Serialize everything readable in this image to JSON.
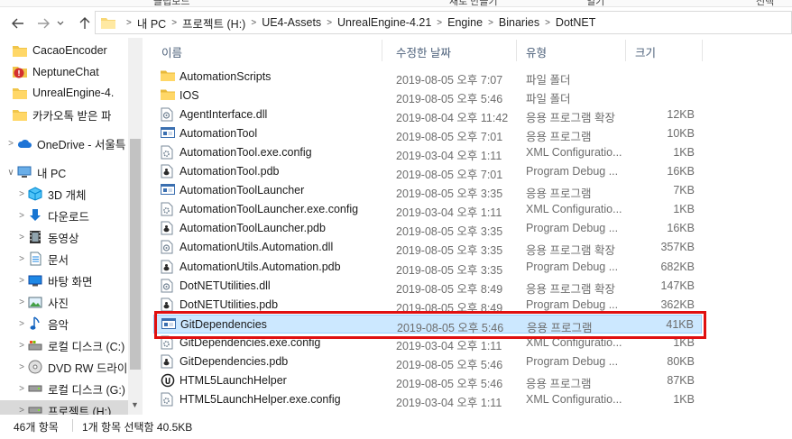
{
  "ribbon": {
    "fragments": [
      "클립보드",
      "새로 만들기",
      "열기",
      "선택"
    ]
  },
  "address_bar": {
    "crumbs": [
      "내 PC",
      "프로젝트 (H:)",
      "UE4-Assets",
      "UnrealEngine-4.21",
      "Engine",
      "Binaries",
      "DotNET"
    ]
  },
  "sidebar": {
    "items": [
      {
        "label": "CacaoEncoder",
        "icon": "folder-icon"
      },
      {
        "label": "NeptuneChat",
        "icon": "folder-error-icon"
      },
      {
        "label": "UnrealEngine-4.",
        "icon": "folder-icon"
      },
      {
        "label": "카카오톡 받은 파",
        "icon": "folder-icon"
      },
      {
        "label": "OneDrive - 서울특",
        "icon": "onedrive-icon"
      },
      {
        "label": "내 PC",
        "icon": "pc-icon"
      },
      {
        "label": "3D 개체",
        "icon": "3d-objects-icon"
      },
      {
        "label": "다운로드",
        "icon": "download-icon"
      },
      {
        "label": "동영상",
        "icon": "video-icon"
      },
      {
        "label": "문서",
        "icon": "document-icon"
      },
      {
        "label": "바탕 화면",
        "icon": "desktop-icon"
      },
      {
        "label": "사진",
        "icon": "pictures-icon"
      },
      {
        "label": "음악",
        "icon": "music-icon"
      },
      {
        "label": "로컬 디스크 (C:)",
        "icon": "local-disk-icon"
      },
      {
        "label": "DVD RW 드라이",
        "icon": "dvd-drive-icon"
      },
      {
        "label": "로컬 디스크 (G:)",
        "icon": "disk-drive-icon"
      },
      {
        "label": "프로젝트 (H:)",
        "icon": "disk-drive-icon"
      }
    ]
  },
  "columns": {
    "name": "이름",
    "date": "수정한 날짜",
    "type": "유형",
    "size": "크기"
  },
  "files": [
    {
      "name": "AutomationScripts",
      "date": "2019-08-05 오후 7:07",
      "type": "파일 폴더",
      "size": "",
      "icon": "folder-icon"
    },
    {
      "name": "IOS",
      "date": "2019-08-05 오후 5:46",
      "type": "파일 폴더",
      "size": "",
      "icon": "folder-icon"
    },
    {
      "name": "AgentInterface.dll",
      "date": "2019-08-04 오후 11:42",
      "type": "응용 프로그램 확장",
      "size": "12KB",
      "icon": "dll-icon"
    },
    {
      "name": "AutomationTool",
      "date": "2019-08-05 오후 7:01",
      "type": "응용 프로그램",
      "size": "10KB",
      "icon": "exe-icon"
    },
    {
      "name": "AutomationTool.exe.config",
      "date": "2019-03-04 오후 1:11",
      "type": "XML Configuratio...",
      "size": "1KB",
      "icon": "config-icon"
    },
    {
      "name": "AutomationTool.pdb",
      "date": "2019-08-05 오후 7:01",
      "type": "Program Debug ...",
      "size": "16KB",
      "icon": "pdb-icon"
    },
    {
      "name": "AutomationToolLauncher",
      "date": "2019-08-05 오후 3:35",
      "type": "응용 프로그램",
      "size": "7KB",
      "icon": "exe-icon"
    },
    {
      "name": "AutomationToolLauncher.exe.config",
      "date": "2019-03-04 오후 1:11",
      "type": "XML Configuratio...",
      "size": "1KB",
      "icon": "config-icon"
    },
    {
      "name": "AutomationToolLauncher.pdb",
      "date": "2019-08-05 오후 3:35",
      "type": "Program Debug ...",
      "size": "16KB",
      "icon": "pdb-icon"
    },
    {
      "name": "AutomationUtils.Automation.dll",
      "date": "2019-08-05 오후 3:35",
      "type": "응용 프로그램 확장",
      "size": "357KB",
      "icon": "dll-icon"
    },
    {
      "name": "AutomationUtils.Automation.pdb",
      "date": "2019-08-05 오후 3:35",
      "type": "Program Debug ...",
      "size": "682KB",
      "icon": "pdb-icon"
    },
    {
      "name": "DotNETUtilities.dll",
      "date": "2019-08-05 오후 8:49",
      "type": "응용 프로그램 확장",
      "size": "147KB",
      "icon": "dll-icon"
    },
    {
      "name": "DotNETUtilities.pdb",
      "date": "2019-08-05 오후 8:49",
      "type": "Program Debug ...",
      "size": "362KB",
      "icon": "pdb-icon"
    },
    {
      "name": "GitDependencies",
      "date": "2019-08-05 오후 5:46",
      "type": "응용 프로그램",
      "size": "41KB",
      "icon": "exe-icon",
      "selected": true
    },
    {
      "name": "GitDependencies.exe.config",
      "date": "2019-03-04 오후 1:11",
      "type": "XML Configuratio...",
      "size": "1KB",
      "icon": "config-icon"
    },
    {
      "name": "GitDependencies.pdb",
      "date": "2019-08-05 오후 5:46",
      "type": "Program Debug ...",
      "size": "80KB",
      "icon": "pdb-icon"
    },
    {
      "name": "HTML5LaunchHelper",
      "date": "2019-08-05 오후 5:46",
      "type": "응용 프로그램",
      "size": "87KB",
      "icon": "unreal-icon"
    },
    {
      "name": "HTML5LaunchHelper.exe.config",
      "date": "2019-03-04 오후 1:11",
      "type": "XML Configuratio...",
      "size": "1KB",
      "icon": "config-icon"
    }
  ],
  "status": {
    "item_count": "46개 항목",
    "selection": "1개 항목 선택함 40.5KB"
  },
  "colors": {
    "selected_row_bg": "#cce8ff",
    "selected_row_border": "#99d1ff",
    "highlight_box": "#e01010",
    "folder_yellow": "#f8d775"
  }
}
